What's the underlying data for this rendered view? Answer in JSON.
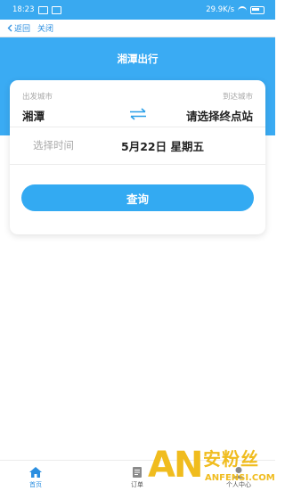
{
  "status_bar": {
    "time": "18:23",
    "network_speed": "29.9K/s"
  },
  "nav": {
    "back_label": "返回",
    "close_label": "关闭"
  },
  "page": {
    "title": "湘潭出行"
  },
  "search_card": {
    "from_label": "出发城市",
    "from_value": "湘潭",
    "to_label": "到达城市",
    "to_value": "请选择终点站",
    "date_label": "选择时间",
    "date_value": "5月22日 星期五",
    "search_button": "查询"
  },
  "tabs": [
    {
      "label": "首页",
      "icon": "home-icon",
      "active": true
    },
    {
      "label": "订单",
      "icon": "order-icon",
      "active": false
    },
    {
      "label": "个人中心",
      "icon": "user-icon",
      "active": false
    }
  ],
  "watermark": {
    "brand_letters": "AN",
    "brand_cn": "安粉丝",
    "domain": "ANFENSI.COM"
  },
  "colors": {
    "primary": "#3aabf3",
    "button": "#33aaf2",
    "watermark": "#f0bc1e",
    "tab_active": "#2a8ee0",
    "tab_inactive": "#8a8a8a"
  }
}
